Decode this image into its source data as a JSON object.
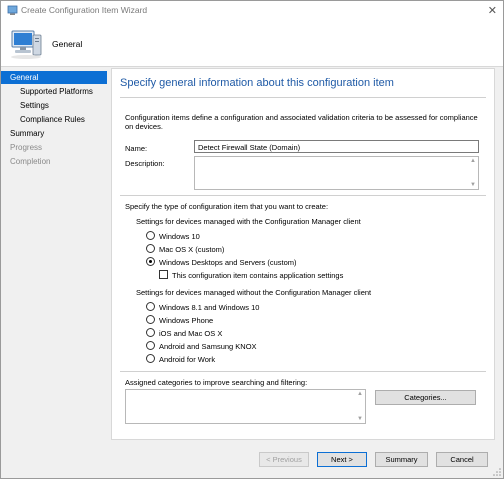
{
  "window": {
    "title": "Create Configuration Item Wizard"
  },
  "header": {
    "title": "General",
    "icon": "computer-icon"
  },
  "sidebar": {
    "items": [
      {
        "label": "General",
        "state": "active"
      },
      {
        "label": "Supported Platforms",
        "state": "normal"
      },
      {
        "label": "Settings",
        "state": "normal"
      },
      {
        "label": "Compliance Rules",
        "state": "normal"
      },
      {
        "label": "Summary",
        "state": "normal"
      },
      {
        "label": "Progress",
        "state": "disabled"
      },
      {
        "label": "Completion",
        "state": "disabled"
      }
    ]
  },
  "main": {
    "heading": "Specify general information about this configuration item",
    "description": "Configuration items define a configuration and associated validation criteria to be assessed for compliance on devices.",
    "name_label": "Name:",
    "name_value": "Detect Firewall State (Domain)",
    "description_label": "Description:",
    "description_value": "",
    "type_prompt": "Specify the type of configuration item that you want to create:",
    "managed_group_label": "Settings for devices managed with the Configuration Manager client",
    "managed_options": [
      {
        "label": "Windows 10",
        "checked": false
      },
      {
        "label": "Mac OS X (custom)",
        "checked": false
      },
      {
        "label": "Windows Desktops and Servers (custom)",
        "checked": true
      }
    ],
    "app_settings_checkbox": {
      "label": "This configuration item contains application settings",
      "checked": false
    },
    "unmanaged_group_label": "Settings for devices managed without the Configuration Manager client",
    "unmanaged_options": [
      {
        "label": "Windows 8.1 and Windows 10",
        "checked": false
      },
      {
        "label": "Windows Phone",
        "checked": false
      },
      {
        "label": "iOS and Mac OS X",
        "checked": false
      },
      {
        "label": "Android and Samsung KNOX",
        "checked": false
      },
      {
        "label": "Android for Work",
        "checked": false
      }
    ],
    "categories_label": "Assigned categories to improve searching and filtering:",
    "categories_button": "Categories..."
  },
  "footer": {
    "previous_label": "< Previous",
    "next_label": "Next >",
    "summary_label": "Summary",
    "cancel_label": "Cancel"
  },
  "colors": {
    "accent": "#0c6fd4",
    "heading": "#1f5aa6"
  }
}
